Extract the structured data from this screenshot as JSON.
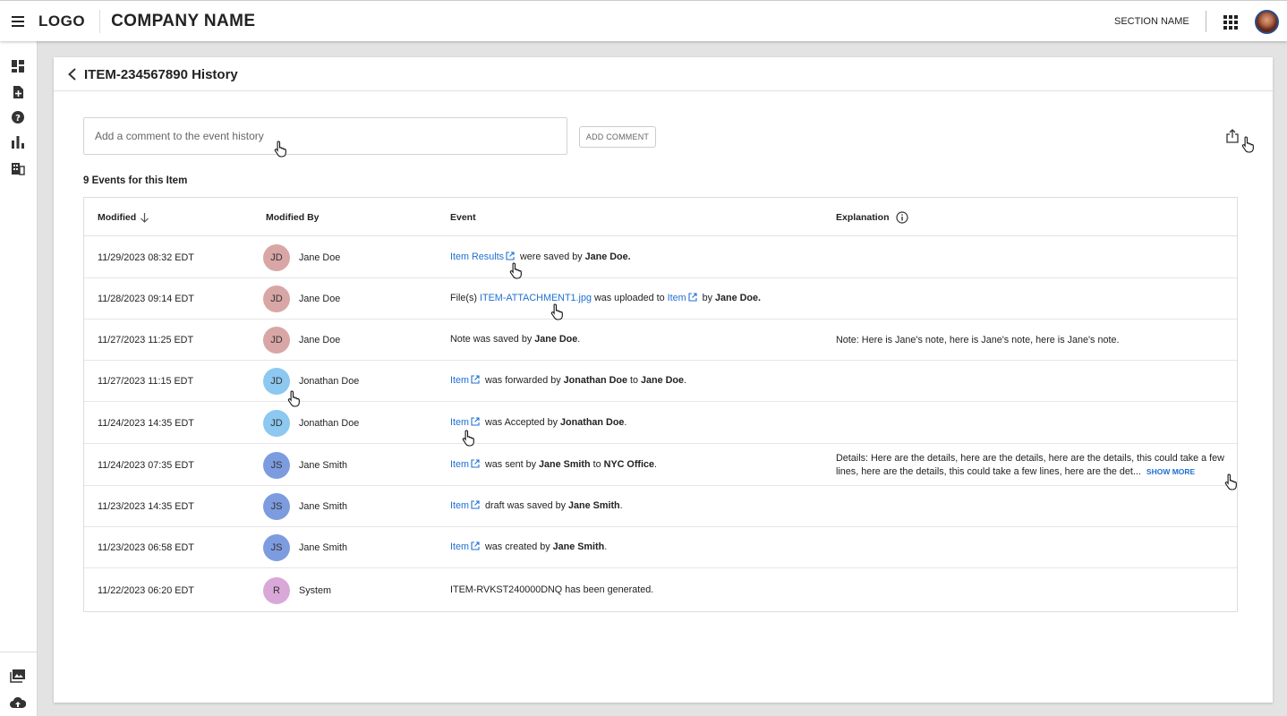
{
  "header": {
    "logo": "LOGO",
    "company_name": "COMPANY NAME",
    "section_name": "SECTION NAME"
  },
  "sidebar": {
    "items": [
      "dashboard-icon",
      "add-document-icon",
      "help-icon",
      "bar-chart-icon",
      "building-icon"
    ],
    "bottom_items": [
      "gallery-icon",
      "cloud-upload-icon"
    ]
  },
  "page": {
    "title": "ITEM-234567890 History",
    "comment_placeholder": "Add a comment to the event history",
    "add_comment_label": "ADD COMMENT",
    "events_count_label": "9 Events for this Item"
  },
  "table": {
    "columns": {
      "modified": "Modified",
      "modified_by": "Modified By",
      "event": "Event",
      "explanation": "Explanation"
    },
    "rows": [
      {
        "date": "11/29/2023 08:32 EDT",
        "initials": "JD",
        "user": "Jane Doe",
        "avatar_color": "#d9a6a6",
        "event": [
          {
            "t": "Item Results",
            "link": true
          },
          {
            "t": " were saved by "
          },
          {
            "t": "Jane Doe.",
            "bold": true
          }
        ],
        "explanation": ""
      },
      {
        "date": "11/28/2023 09:14 EDT",
        "initials": "JD",
        "user": "Jane Doe",
        "avatar_color": "#d9a6a6",
        "event": [
          {
            "t": "File(s) "
          },
          {
            "t": "ITEM-ATTACHMENT1.jpg",
            "link": true,
            "noicon": true
          },
          {
            "t": " was uploaded to "
          },
          {
            "t": "Item",
            "link": true
          },
          {
            "t": " by "
          },
          {
            "t": "Jane Doe.",
            "bold": true
          }
        ],
        "explanation": ""
      },
      {
        "date": "11/27/2023 11:25 EDT",
        "initials": "JD",
        "user": "Jane Doe",
        "avatar_color": "#d9a6a6",
        "event": [
          {
            "t": "Note was saved by "
          },
          {
            "t": "Jane Doe",
            "bold": true
          },
          {
            "t": "."
          }
        ],
        "explanation": "Note: Here is Jane's note, here is Jane's note, here is Jane's note."
      },
      {
        "date": "11/27/2023 11:15 EDT",
        "initials": "JD",
        "user": "Jonathan Doe",
        "avatar_color": "#8cc8f0",
        "event": [
          {
            "t": "Item",
            "link": true
          },
          {
            "t": " was forwarded by "
          },
          {
            "t": "Jonathan Doe",
            "bold": true
          },
          {
            "t": " to "
          },
          {
            "t": "Jane Doe",
            "bold": true
          },
          {
            "t": "."
          }
        ],
        "explanation": ""
      },
      {
        "date": "11/24/2023 14:35 EDT",
        "initials": "JD",
        "user": "Jonathan Doe",
        "avatar_color": "#8cc8f0",
        "event": [
          {
            "t": "Item",
            "link": true
          },
          {
            "t": " was Accepted by "
          },
          {
            "t": "Jonathan Doe",
            "bold": true
          },
          {
            "t": "."
          }
        ],
        "explanation": ""
      },
      {
        "date": "11/24/2023 07:35 EDT",
        "initials": "JS",
        "user": "Jane Smith",
        "avatar_color": "#7d9ce0",
        "event": [
          {
            "t": "Item",
            "link": true
          },
          {
            "t": " was sent by "
          },
          {
            "t": "Jane Smith",
            "bold": true
          },
          {
            "t": " to "
          },
          {
            "t": "NYC Office",
            "bold": true
          },
          {
            "t": "."
          }
        ],
        "explanation": "Details: Here are the details, here are the details, here are the details, this could take a few lines, here are the details, this could take a few lines, here are the det...",
        "show_more": "SHOW MORE"
      },
      {
        "date": "11/23/2023 14:35 EDT",
        "initials": "JS",
        "user": "Jane Smith",
        "avatar_color": "#7d9ce0",
        "event": [
          {
            "t": "Item",
            "link": true
          },
          {
            "t": " draft was saved by "
          },
          {
            "t": "Jane Smith",
            "bold": true
          },
          {
            "t": "."
          }
        ],
        "explanation": ""
      },
      {
        "date": "11/23/2023 06:58 EDT",
        "initials": "JS",
        "user": "Jane Smith",
        "avatar_color": "#7d9ce0",
        "event": [
          {
            "t": "Item",
            "link": true
          },
          {
            "t": " was created by "
          },
          {
            "t": "Jane Smith",
            "bold": true
          },
          {
            "t": "."
          }
        ],
        "explanation": ""
      },
      {
        "date": "11/22/2023 06:20 EDT",
        "initials": "R",
        "user": "System",
        "avatar_color": "#d9a8d8",
        "event": [
          {
            "t": "ITEM-RVKST240000DNQ has been generated."
          }
        ],
        "explanation": ""
      }
    ]
  },
  "colors": {
    "link": "#1f6fd1",
    "accent_avatar_ring": "#2b4d8a"
  }
}
